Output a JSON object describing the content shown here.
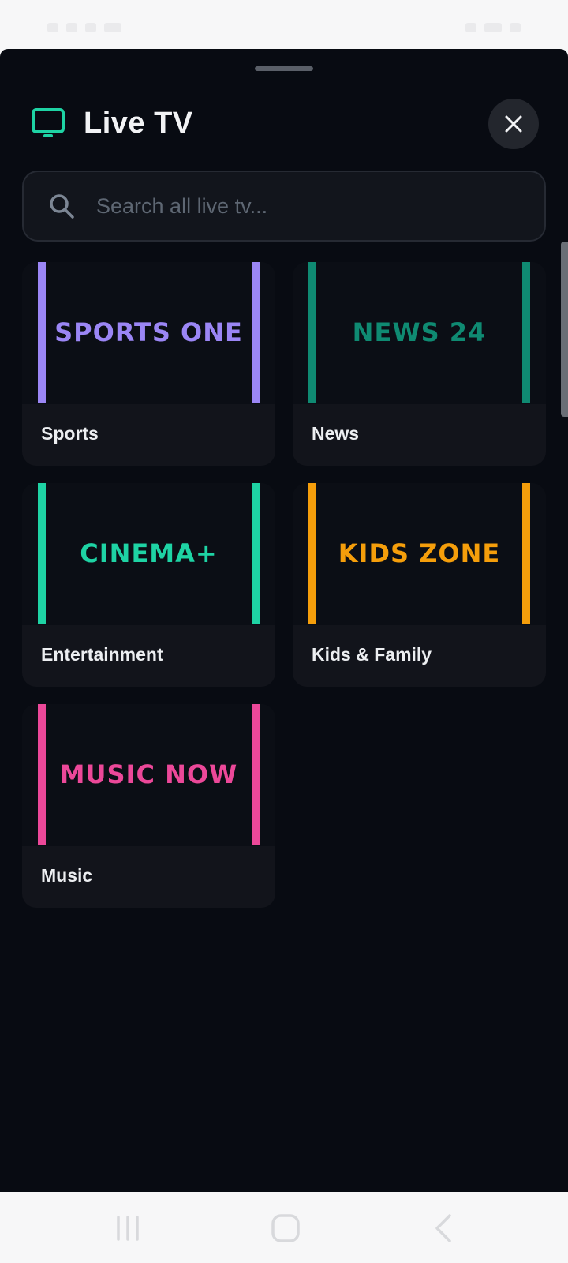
{
  "header": {
    "title": "Live TV",
    "icon": "tv-icon",
    "accent_color": "#1ed3a4"
  },
  "search": {
    "placeholder": "Search all live tv...",
    "value": ""
  },
  "channels": [
    {
      "logo_text": "SPORTS ONE",
      "category": "Sports",
      "color": "#9b86f5"
    },
    {
      "logo_text": "NEWS 24",
      "category": "News",
      "color": "#0f8a72"
    },
    {
      "logo_text": "CINEMA+",
      "category": "Entertainment",
      "color": "#1ed3a4"
    },
    {
      "logo_text": "KIDS ZONE",
      "category": "Kids & Family",
      "color": "#f59e0b"
    },
    {
      "logo_text": "MUSIC NOW",
      "category": "Music",
      "color": "#ec4899"
    }
  ],
  "nav": {
    "recents": "recents-icon",
    "home": "home-icon",
    "back": "back-icon"
  }
}
